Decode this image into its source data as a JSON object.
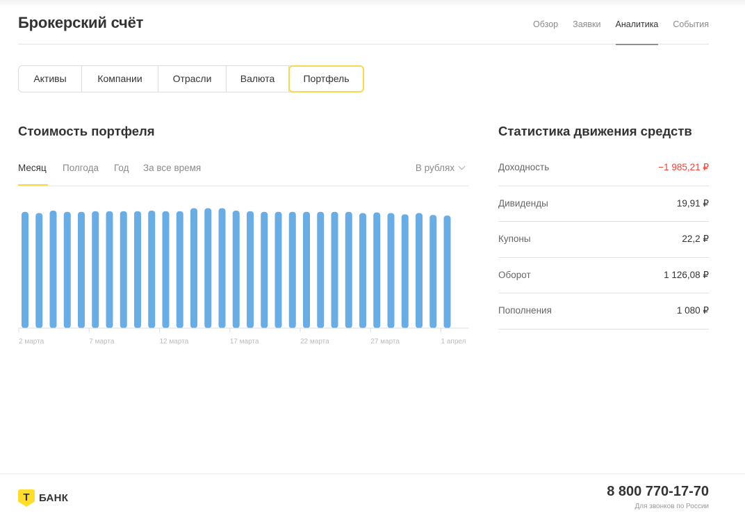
{
  "header": {
    "title": "Брокерский счёт",
    "nav": [
      "Обзор",
      "Заявки",
      "Аналитика",
      "События"
    ],
    "active_nav": "Аналитика"
  },
  "segments": {
    "items": [
      "Активы",
      "Компании",
      "Отрасли",
      "Валюта",
      "Портфель"
    ],
    "active": "Портфель"
  },
  "portfolio": {
    "title": "Стоимость портфеля",
    "tabs": [
      "Месяц",
      "Полгода",
      "Год",
      "За все время"
    ],
    "active_tab": "Месяц",
    "currency": "В рублях"
  },
  "chart_data": {
    "type": "bar",
    "x_tick_labels": [
      "2 марта",
      "7 марта",
      "12 марта",
      "17 марта",
      "22 марта",
      "27 марта",
      "1 апрел"
    ],
    "values": [
      0.95,
      0.94,
      0.96,
      0.95,
      0.95,
      0.955,
      0.955,
      0.955,
      0.955,
      0.96,
      0.955,
      0.955,
      0.98,
      0.98,
      0.98,
      0.96,
      0.955,
      0.95,
      0.95,
      0.95,
      0.95,
      0.95,
      0.95,
      0.95,
      0.94,
      0.945,
      0.94,
      0.93,
      0.94,
      0.925,
      0.92
    ],
    "bar_color": "#6aade4",
    "axis_color": "#dcdcdc",
    "tick_color": "#bbbbbb"
  },
  "stats": {
    "title": "Статистика движения средств",
    "rows": [
      {
        "label": "Доходность",
        "value": "−1 985,21 ₽",
        "negative": true
      },
      {
        "label": "Дивиденды",
        "value": "19,91 ₽",
        "negative": false
      },
      {
        "label": "Купоны",
        "value": "22,2 ₽",
        "negative": false
      },
      {
        "label": "Оборот",
        "value": "1 126,08 ₽",
        "negative": false
      },
      {
        "label": "Пополнения",
        "value": "1 080 ₽",
        "negative": false
      }
    ],
    "negative_color": "#f0413a"
  },
  "footer": {
    "logo_mark": "Т",
    "logo_text": "БАНК",
    "phone": "8 800 770-17-70",
    "phone_note": "Для звонков по России"
  }
}
